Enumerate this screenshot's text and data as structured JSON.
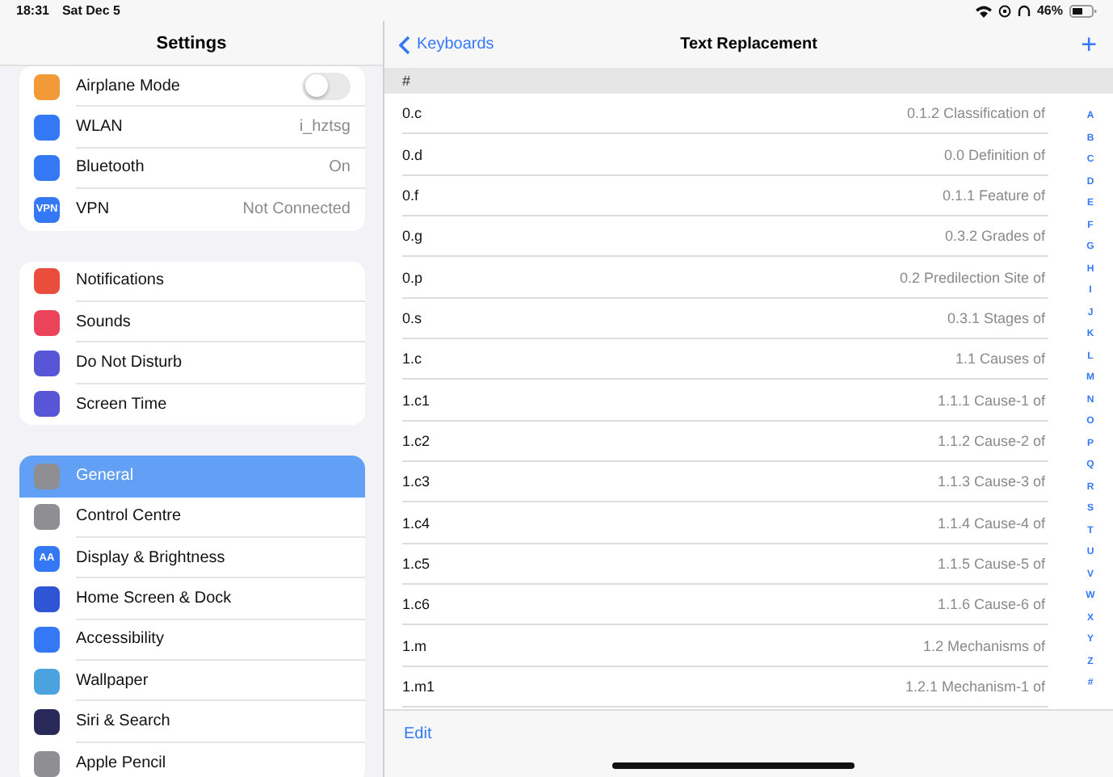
{
  "status_bar": {
    "time": "18:31",
    "date": "Sat Dec 5",
    "battery": "46%"
  },
  "sidebar": {
    "title": "Settings",
    "groups": [
      {
        "items": [
          {
            "label": "Airplane Mode",
            "kind": "toggle",
            "on": false,
            "selected": false,
            "color": "#f19a37"
          },
          {
            "label": "WLAN",
            "kind": "value",
            "value": "i_hztsg",
            "selected": false,
            "color": "#3478f6"
          },
          {
            "label": "Bluetooth",
            "kind": "value",
            "value": "On",
            "selected": false,
            "color": "#3478f6"
          },
          {
            "label": "VPN",
            "kind": "value",
            "value": "Not Connected",
            "selected": false,
            "color": "#3478f6",
            "badge": "VPN"
          }
        ]
      },
      {
        "items": [
          {
            "label": "Notifications",
            "kind": "plain",
            "selected": false,
            "color": "#eb4d3d"
          },
          {
            "label": "Sounds",
            "kind": "plain",
            "selected": false,
            "color": "#eb445a"
          },
          {
            "label": "Do Not Disturb",
            "kind": "plain",
            "selected": false,
            "color": "#5856d6"
          },
          {
            "label": "Screen Time",
            "kind": "plain",
            "selected": false,
            "color": "#5856d6"
          }
        ]
      },
      {
        "items": [
          {
            "label": "General",
            "kind": "plain",
            "selected": true,
            "color": "#8e8e93"
          },
          {
            "label": "Control Centre",
            "kind": "plain",
            "selected": false,
            "color": "#8e8e93"
          },
          {
            "label": "Display & Brightness",
            "kind": "plain",
            "selected": false,
            "color": "#3478f6",
            "badge": "AA"
          },
          {
            "label": "Home Screen & Dock",
            "kind": "plain",
            "selected": false,
            "color": "#2f55d4"
          },
          {
            "label": "Accessibility",
            "kind": "plain",
            "selected": false,
            "color": "#3478f6"
          },
          {
            "label": "Wallpaper",
            "kind": "plain",
            "selected": false,
            "color": "#4aa3df"
          },
          {
            "label": "Siri & Search",
            "kind": "plain",
            "selected": false,
            "color": "#2a2a5a"
          },
          {
            "label": "Apple Pencil",
            "kind": "plain",
            "selected": false,
            "color": "#8e8e93"
          }
        ]
      }
    ]
  },
  "detail": {
    "back": "Keyboards",
    "title": "Text Replacement",
    "add": "+",
    "section": "#",
    "rows": [
      {
        "shortcut": "0.c",
        "phrase": "0.1.2 Classification of"
      },
      {
        "shortcut": "0.d",
        "phrase": "0.0 Definition of"
      },
      {
        "shortcut": "0.f",
        "phrase": "0.1.1 Feature of"
      },
      {
        "shortcut": "0.g",
        "phrase": "0.3.2 Grades of"
      },
      {
        "shortcut": "0.p",
        "phrase": "0.2 Predilection Site of"
      },
      {
        "shortcut": "0.s",
        "phrase": "0.3.1 Stages of"
      },
      {
        "shortcut": "1.c",
        "phrase": "1.1 Causes of"
      },
      {
        "shortcut": "1.c1",
        "phrase": "1.1.1 Cause-1 of"
      },
      {
        "shortcut": "1.c2",
        "phrase": "1.1.2 Cause-2 of"
      },
      {
        "shortcut": "1.c3",
        "phrase": "1.1.3 Cause-3 of"
      },
      {
        "shortcut": "1.c4",
        "phrase": "1.1.4 Cause-4 of"
      },
      {
        "shortcut": "1.c5",
        "phrase": "1.1.5 Cause-5 of"
      },
      {
        "shortcut": "1.c6",
        "phrase": "1.1.6 Cause-6 of"
      },
      {
        "shortcut": "1.m",
        "phrase": "1.2 Mechanisms of"
      },
      {
        "shortcut": "1.m1",
        "phrase": "1.2.1 Mechanism-1 of"
      }
    ],
    "index": [
      "A",
      "B",
      "C",
      "D",
      "E",
      "F",
      "G",
      "H",
      "I",
      "J",
      "K",
      "L",
      "M",
      "N",
      "O",
      "P",
      "Q",
      "R",
      "S",
      "T",
      "U",
      "V",
      "W",
      "X",
      "Y",
      "Z",
      "#"
    ],
    "edit": "Edit"
  }
}
